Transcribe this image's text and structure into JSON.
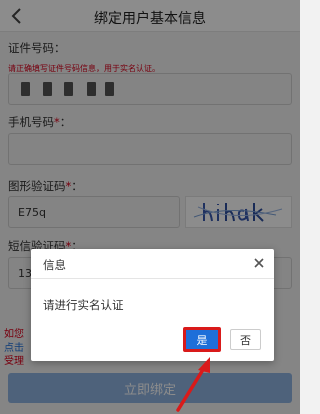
{
  "header": {
    "title": "绑定用户基本信息"
  },
  "form": {
    "id_label": "证件号码：",
    "id_hint": "请正确填写证件号码信息，用于实名认证。",
    "phone_label": "手机号码",
    "captcha_label": "图形验证码",
    "captcha_value": "E75q",
    "sms_label": "短信验证码",
    "sms_value": "13",
    "required_mark": "*",
    "colon": "："
  },
  "background_fragments": {
    "line1": "如您",
    "line2": "点击",
    "line3": "受理"
  },
  "submit_label": "立即绑定",
  "dialog": {
    "title": "信息",
    "message": "请进行实名认证",
    "confirm_label": "是",
    "cancel_label": "否"
  },
  "colors": {
    "primary_blue": "#1e6fd9",
    "highlight_red": "#d91a1a",
    "required_red": "#d9001b"
  },
  "icons": [
    "back-arrow-icon",
    "close-icon",
    "annotation-arrow"
  ]
}
